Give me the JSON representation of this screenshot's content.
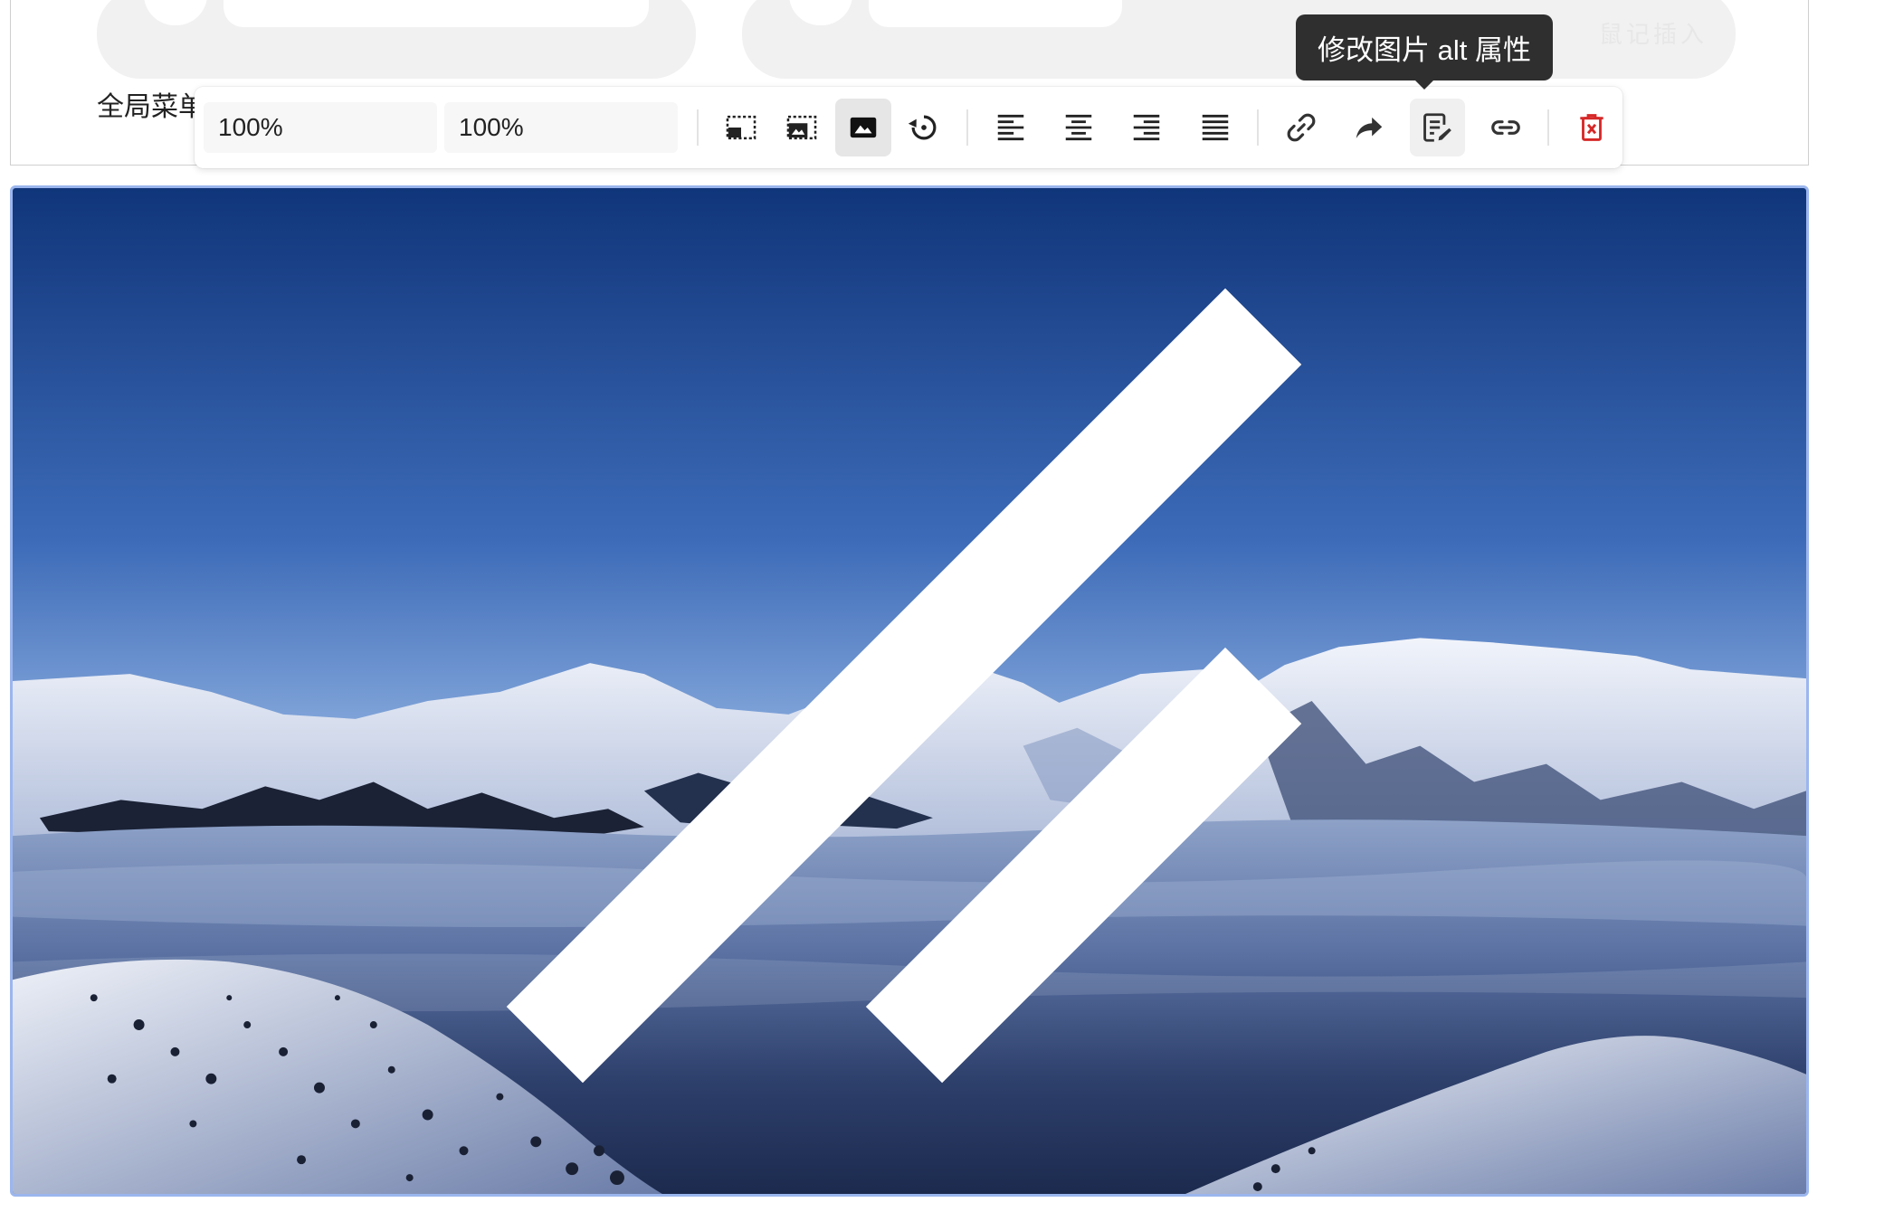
{
  "header": {
    "menu_label": "全局菜单",
    "faint_text": "鼠记插入"
  },
  "toolbar": {
    "width_value": "100%",
    "height_value": "100%",
    "buttons": [
      {
        "name": "image-size-small",
        "icon": "image-small-icon",
        "state": "normal"
      },
      {
        "name": "image-size-medium",
        "icon": "image-medium-icon",
        "state": "normal"
      },
      {
        "name": "image-size-full",
        "icon": "image-full-icon",
        "state": "active"
      },
      {
        "name": "image-reset",
        "icon": "reset-icon",
        "state": "normal"
      },
      {
        "name": "align-left",
        "icon": "align-left-icon",
        "state": "normal"
      },
      {
        "name": "align-center",
        "icon": "align-center-icon",
        "state": "normal"
      },
      {
        "name": "align-right",
        "icon": "align-right-icon",
        "state": "normal"
      },
      {
        "name": "align-justify",
        "icon": "align-justify-icon",
        "state": "normal"
      },
      {
        "name": "insert-link",
        "icon": "link-icon",
        "state": "normal"
      },
      {
        "name": "open-link",
        "icon": "share-arrow-icon",
        "state": "normal"
      },
      {
        "name": "edit-alt",
        "icon": "edit-note-icon",
        "state": "hover"
      },
      {
        "name": "image-link",
        "icon": "link-alt-icon",
        "state": "normal"
      },
      {
        "name": "delete-image",
        "icon": "trash-icon",
        "state": "normal"
      }
    ]
  },
  "tooltip": {
    "text": "修改图片 alt 属性"
  },
  "image": {
    "subject": "snowy mountains above sea of clouds at dusk"
  },
  "colors": {
    "tooltip_bg": "#2f2f2f",
    "selection_border": "#9bb6ee",
    "delete_red": "#d62828",
    "active_button_bg": "#e6e6e6"
  }
}
